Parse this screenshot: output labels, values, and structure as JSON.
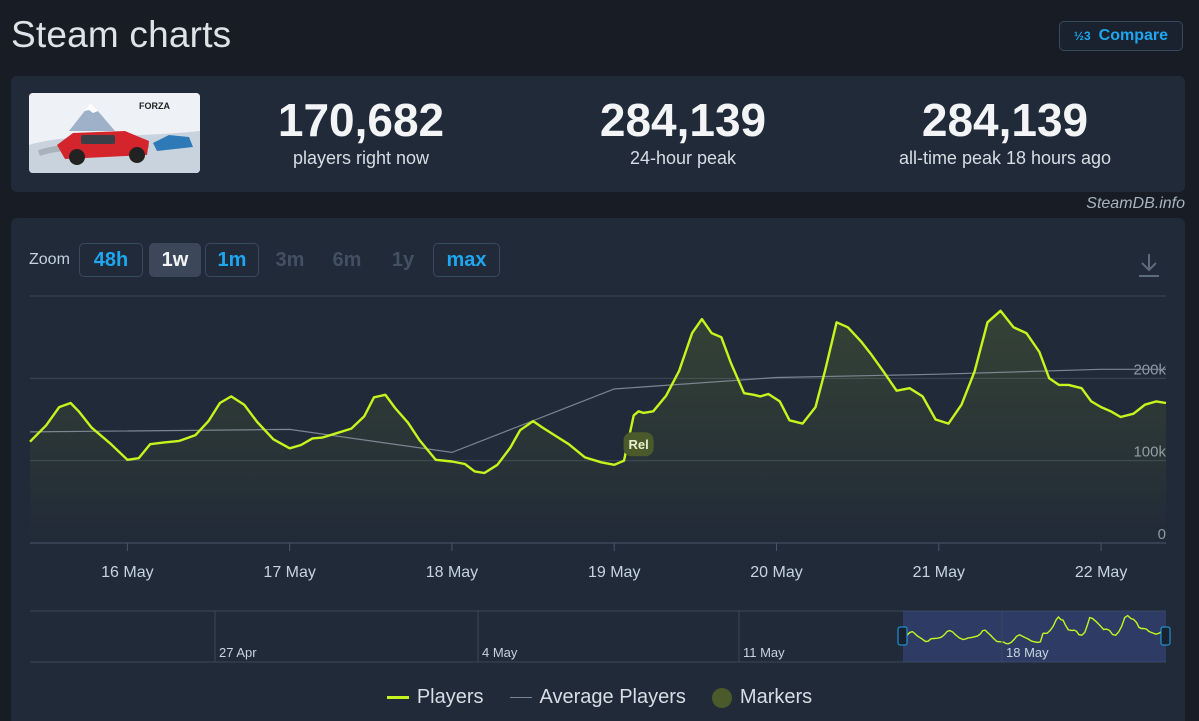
{
  "header": {
    "title": "Steam charts",
    "compare_label": "Compare",
    "compare_icon": "½3"
  },
  "stats": [
    {
      "value": "170,682",
      "label": "players right now"
    },
    {
      "value": "284,139",
      "label": "24-hour peak"
    },
    {
      "value": "284,139",
      "label": "all-time peak 18 hours ago"
    }
  ],
  "game": {
    "logo_text": "FORZA"
  },
  "credit": "SteamDB.info",
  "zoom": {
    "label": "Zoom",
    "buttons": [
      {
        "label": "48h",
        "state": "link"
      },
      {
        "label": "1w",
        "state": "selected"
      },
      {
        "label": "1m",
        "state": "link"
      },
      {
        "label": "3m",
        "state": "disabled"
      },
      {
        "label": "6m",
        "state": "disabled"
      },
      {
        "label": "1y",
        "state": "disabled"
      },
      {
        "label": "max",
        "state": "link"
      }
    ]
  },
  "legend": {
    "players": "Players",
    "average": "Average Players",
    "markers": "Markers"
  },
  "colors": {
    "players": "#c6f51e",
    "average": "#7c8591",
    "marker": "#4b5a2a",
    "background": "#212a38",
    "accent": "#1ea7f0"
  },
  "chart_data": {
    "type": "line",
    "x_unit": "days from 15 May 00:00",
    "xlim": [
      0.4,
      7.4
    ],
    "ylim": [
      0,
      300000
    ],
    "y_ticks": [
      0,
      100000,
      200000
    ],
    "y_tick_labels": [
      "0",
      "100k",
      "200k"
    ],
    "x_ticks": [
      1,
      2,
      3,
      4,
      5,
      6,
      7
    ],
    "x_tick_labels": [
      "16 May",
      "17 May",
      "18 May",
      "19 May",
      "20 May",
      "21 May",
      "22 May"
    ],
    "series": [
      {
        "name": "Players",
        "x": [
          0.4,
          0.5,
          0.58,
          0.65,
          0.7,
          0.78,
          0.9,
          1.0,
          1.07,
          1.14,
          1.22,
          1.32,
          1.42,
          1.5,
          1.57,
          1.64,
          1.72,
          1.8,
          1.9,
          2.0,
          2.07,
          2.14,
          2.2,
          2.3,
          2.38,
          2.46,
          2.52,
          2.59,
          2.65,
          2.73,
          2.8,
          2.9,
          3.0,
          3.08,
          3.14,
          3.2,
          3.28,
          3.36,
          3.42,
          3.5,
          3.56,
          3.64,
          3.72,
          3.82,
          3.92,
          4.0,
          4.06,
          4.12,
          4.15,
          4.18,
          4.24,
          4.32,
          4.4,
          4.48,
          4.54,
          4.6,
          4.66,
          4.72,
          4.8,
          4.86,
          4.9,
          4.95,
          5.02,
          5.08,
          5.16,
          5.24,
          5.3,
          5.37,
          5.44,
          5.52,
          5.58,
          5.66,
          5.74,
          5.82,
          5.9,
          5.98,
          6.06,
          6.14,
          6.22,
          6.3,
          6.38,
          6.46,
          6.54,
          6.62,
          6.68,
          6.74,
          6.8,
          6.88,
          6.94,
          7.0,
          7.06,
          7.12,
          7.2,
          7.27,
          7.34,
          7.4
        ],
        "y": [
          123000,
          143000,
          165000,
          170000,
          160000,
          140000,
          120000,
          101000,
          103000,
          120000,
          122000,
          124000,
          131000,
          148000,
          170000,
          178000,
          168000,
          147000,
          126000,
          115000,
          119000,
          127000,
          128000,
          134000,
          139000,
          154000,
          177000,
          180000,
          164000,
          146000,
          125000,
          101000,
          99000,
          96000,
          87000,
          85000,
          95000,
          116000,
          137000,
          148000,
          140000,
          130000,
          120000,
          104000,
          98000,
          95000,
          100000,
          155000,
          160000,
          158000,
          160000,
          179000,
          209000,
          255000,
          272000,
          255000,
          250000,
          218000,
          182000,
          180000,
          178000,
          181000,
          172000,
          149000,
          145000,
          165000,
          210000,
          268000,
          262000,
          245000,
          230000,
          208000,
          185000,
          188000,
          178000,
          150000,
          145000,
          168000,
          208000,
          268000,
          282000,
          262000,
          255000,
          232000,
          200000,
          192000,
          192000,
          188000,
          172000,
          165000,
          160000,
          153000,
          157000,
          168000,
          172000,
          170000
        ]
      },
      {
        "name": "Average Players",
        "x": [
          0.4,
          2.0,
          3.0,
          4.0,
          5.0,
          6.0,
          7.0,
          7.4
        ],
        "y": [
          135000,
          138000,
          110000,
          187000,
          201000,
          205000,
          211000,
          211000
        ]
      }
    ],
    "markers": [
      {
        "label": "Rel",
        "x": 4.15,
        "y": 120000
      }
    ],
    "navigator": {
      "x_tick_labels": [
        "27 Apr",
        "4 May",
        "11 May",
        "18 May"
      ]
    }
  }
}
